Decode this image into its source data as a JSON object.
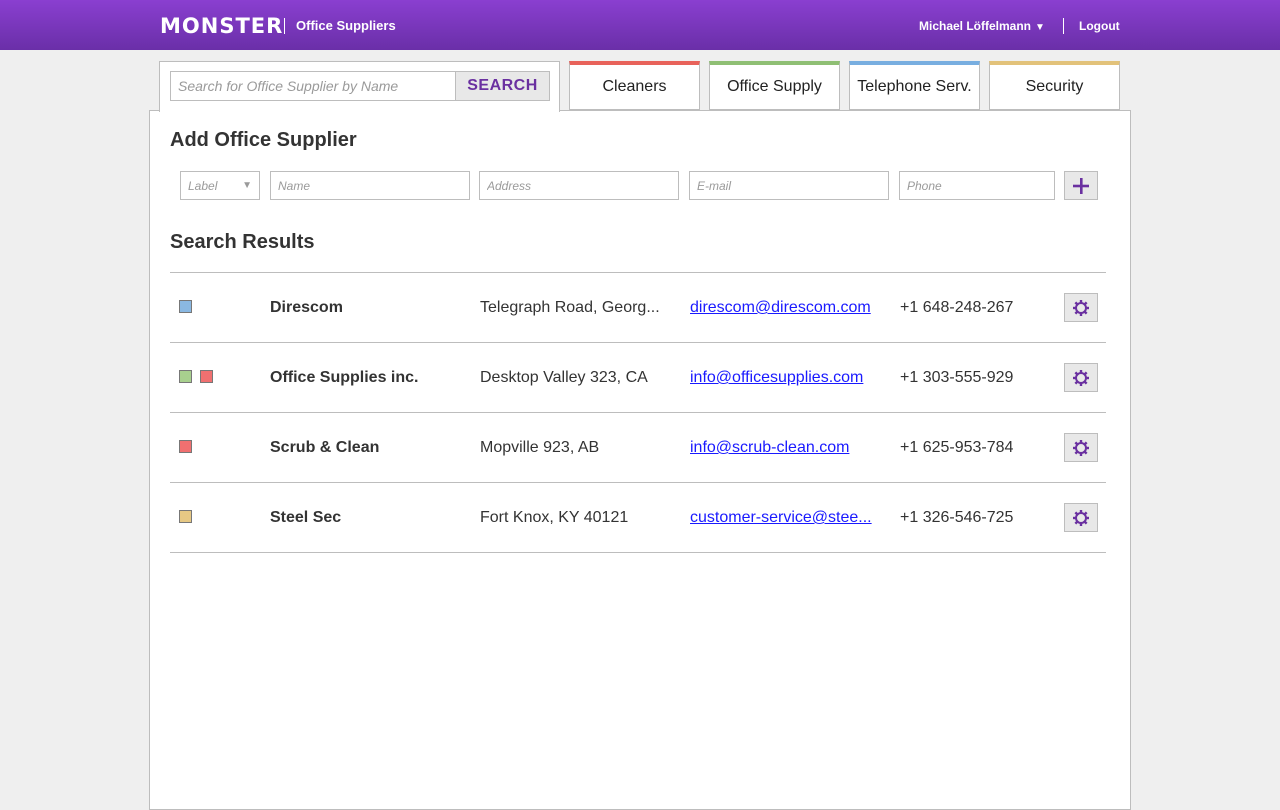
{
  "header": {
    "logo": "MONSTER",
    "section_title": "Office Suppliers",
    "user_name": "Michael Löffelmann",
    "user_caret": "▼",
    "logout": "Logout"
  },
  "search": {
    "placeholder": "Search for Office Supplier by Name",
    "button_label": "SEARCH"
  },
  "tabs": [
    {
      "label": "Cleaners",
      "color": "#e8625a"
    },
    {
      "label": "Office Supply",
      "color": "#8fbf74"
    },
    {
      "label": "Telephone Serv.",
      "color": "#78aee0"
    },
    {
      "label": "Security",
      "color": "#e2c27a"
    }
  ],
  "add_form": {
    "title": "Add Office Supplier",
    "label_placeholder": "Label",
    "name_placeholder": "Name",
    "address_placeholder": "Address",
    "email_placeholder": "E-mail",
    "phone_placeholder": "Phone",
    "add_icon": "plus-icon"
  },
  "results": {
    "title": "Search Results",
    "rows": [
      {
        "labels": [
          "#8ab8e2"
        ],
        "name": "Direscom",
        "address": "Telegraph Road, Georg...",
        "email": "direscom@direscom.com",
        "phone": "+1 648-248-267"
      },
      {
        "labels": [
          "#a8d08e",
          "#f07070"
        ],
        "name": "Office Supplies inc.",
        "address": "Desktop Valley 323, CA",
        "email": "info@officesupplies.com",
        "phone": "+1 303-555-929"
      },
      {
        "labels": [
          "#f07070"
        ],
        "name": "Scrub & Clean",
        "address": "Mopville 923, AB",
        "email": "info@scrub-clean.com",
        "phone": "+1 625-953-784"
      },
      {
        "labels": [
          "#e6c884"
        ],
        "name": "Steel Sec",
        "address": "Fort Knox, KY 40121",
        "email": "customer-service@stee...",
        "phone": "+1 326-546-725"
      }
    ]
  },
  "colors": {
    "accent": "#7a35bf",
    "header_top": "#8a3fd0",
    "header_bottom": "#6a2fa8"
  }
}
